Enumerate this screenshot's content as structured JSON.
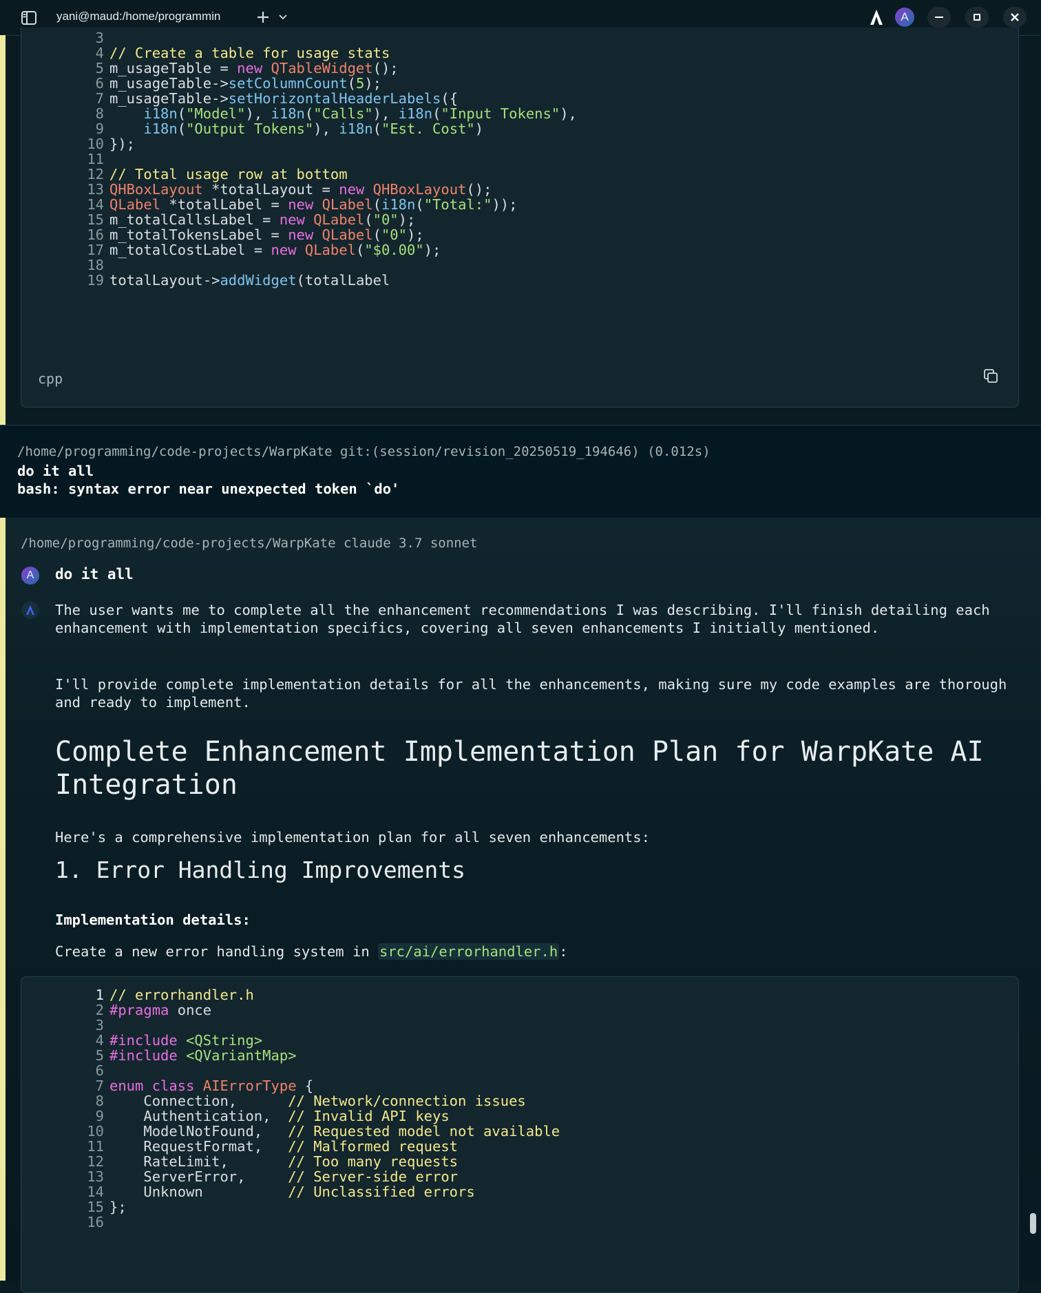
{
  "titlebar": {
    "tab_title": "yani@maud:/home/programmin",
    "icons": [
      "sidebar-icon",
      "plus-icon",
      "chevron-down-icon",
      "warp-logo-icon",
      "avatar",
      "minimize-icon",
      "maximize-icon",
      "close-icon"
    ],
    "avatar_letter": "A"
  },
  "colors": {
    "background": "#0b1b22",
    "accent_strip": "#eee9a0",
    "tab_underline": "#7a3ec9",
    "comment": "#f3e88a",
    "keyword": "#e86fe0",
    "type": "#f0826a",
    "function": "#7fc4ee",
    "string": "#a7e07a"
  },
  "code_block_1": {
    "language": "cpp",
    "lines": [
      {
        "n": "3",
        "tokens": []
      },
      {
        "n": "4",
        "tokens": [
          {
            "t": "// Create a table for usage stats",
            "c": "cm"
          }
        ]
      },
      {
        "n": "5",
        "tokens": [
          {
            "t": "m_usageTable = ",
            "c": ""
          },
          {
            "t": "new",
            "c": "kw"
          },
          {
            "t": " ",
            "c": ""
          },
          {
            "t": "QTableWidget",
            "c": "ty"
          },
          {
            "t": "();",
            "c": ""
          }
        ]
      },
      {
        "n": "6",
        "tokens": [
          {
            "t": "m_usageTable->",
            "c": ""
          },
          {
            "t": "setColumnCount",
            "c": "fn"
          },
          {
            "t": "(",
            "c": ""
          },
          {
            "t": "5",
            "c": "nu"
          },
          {
            "t": ");",
            "c": ""
          }
        ]
      },
      {
        "n": "7",
        "tokens": [
          {
            "t": "m_usageTable->",
            "c": ""
          },
          {
            "t": "setHorizontalHeaderLabels",
            "c": "fn"
          },
          {
            "t": "({",
            "c": ""
          }
        ]
      },
      {
        "n": "8",
        "tokens": [
          {
            "t": "    ",
            "c": ""
          },
          {
            "t": "i18n",
            "c": "fn"
          },
          {
            "t": "(",
            "c": ""
          },
          {
            "t": "\"Model\"",
            "c": "st"
          },
          {
            "t": "), ",
            "c": ""
          },
          {
            "t": "i18n",
            "c": "fn"
          },
          {
            "t": "(",
            "c": ""
          },
          {
            "t": "\"Calls\"",
            "c": "st"
          },
          {
            "t": "), ",
            "c": ""
          },
          {
            "t": "i18n",
            "c": "fn"
          },
          {
            "t": "(",
            "c": ""
          },
          {
            "t": "\"Input Tokens\"",
            "c": "st"
          },
          {
            "t": "),",
            "c": ""
          }
        ]
      },
      {
        "n": "9",
        "tokens": [
          {
            "t": "    ",
            "c": ""
          },
          {
            "t": "i18n",
            "c": "fn"
          },
          {
            "t": "(",
            "c": ""
          },
          {
            "t": "\"Output Tokens\"",
            "c": "st"
          },
          {
            "t": "), ",
            "c": ""
          },
          {
            "t": "i18n",
            "c": "fn"
          },
          {
            "t": "(",
            "c": ""
          },
          {
            "t": "\"Est. Cost\"",
            "c": "st"
          },
          {
            "t": ")",
            "c": ""
          }
        ]
      },
      {
        "n": "10",
        "tokens": [
          {
            "t": "});",
            "c": ""
          }
        ]
      },
      {
        "n": "11",
        "tokens": []
      },
      {
        "n": "12",
        "tokens": [
          {
            "t": "// Total usage row at bottom",
            "c": "cm"
          }
        ]
      },
      {
        "n": "13",
        "tokens": [
          {
            "t": "QHBoxLayout",
            "c": "ty"
          },
          {
            "t": " *totalLayout = ",
            "c": ""
          },
          {
            "t": "new",
            "c": "kw"
          },
          {
            "t": " ",
            "c": ""
          },
          {
            "t": "QHBoxLayout",
            "c": "ty"
          },
          {
            "t": "();",
            "c": ""
          }
        ]
      },
      {
        "n": "14",
        "tokens": [
          {
            "t": "QLabel",
            "c": "ty"
          },
          {
            "t": " *totalLabel = ",
            "c": ""
          },
          {
            "t": "new",
            "c": "kw"
          },
          {
            "t": " ",
            "c": ""
          },
          {
            "t": "QLabel",
            "c": "ty"
          },
          {
            "t": "(",
            "c": ""
          },
          {
            "t": "i18n",
            "c": "fn"
          },
          {
            "t": "(",
            "c": ""
          },
          {
            "t": "\"Total:\"",
            "c": "st"
          },
          {
            "t": "));",
            "c": ""
          }
        ]
      },
      {
        "n": "15",
        "tokens": [
          {
            "t": "m_totalCallsLabel = ",
            "c": ""
          },
          {
            "t": "new",
            "c": "kw"
          },
          {
            "t": " ",
            "c": ""
          },
          {
            "t": "QLabel",
            "c": "ty"
          },
          {
            "t": "(",
            "c": ""
          },
          {
            "t": "\"0\"",
            "c": "st"
          },
          {
            "t": ");",
            "c": ""
          }
        ]
      },
      {
        "n": "16",
        "tokens": [
          {
            "t": "m_totalTokensLabel = ",
            "c": ""
          },
          {
            "t": "new",
            "c": "kw"
          },
          {
            "t": " ",
            "c": ""
          },
          {
            "t": "QLabel",
            "c": "ty"
          },
          {
            "t": "(",
            "c": ""
          },
          {
            "t": "\"0\"",
            "c": "st"
          },
          {
            "t": ");",
            "c": ""
          }
        ]
      },
      {
        "n": "17",
        "tokens": [
          {
            "t": "m_totalCostLabel = ",
            "c": ""
          },
          {
            "t": "new",
            "c": "kw"
          },
          {
            "t": " ",
            "c": ""
          },
          {
            "t": "QLabel",
            "c": "ty"
          },
          {
            "t": "(",
            "c": ""
          },
          {
            "t": "\"$0.00\"",
            "c": "st"
          },
          {
            "t": ");",
            "c": ""
          }
        ]
      },
      {
        "n": "18",
        "tokens": []
      },
      {
        "n": "19",
        "tokens": [
          {
            "t": "totalLayout->",
            "c": ""
          },
          {
            "t": "addWidget",
            "c": "fn"
          },
          {
            "t": "(totalLabel",
            "c": ""
          }
        ]
      }
    ]
  },
  "shell": {
    "path_line": "/home/programming/code-projects/WarpKate git:(session/revision_20250519_194646) (0.012s)",
    "command": "do it all",
    "error": "bash: syntax error near unexpected token `do'"
  },
  "ai": {
    "path_line": "/home/programming/code-projects/WarpKate claude 3.7 sonnet",
    "user_avatar_letter": "A",
    "user_message": "do it all",
    "thinking_1": "The user wants me to complete all the enhancement recommendations I was describing. I'll finish detailing each enhancement with implementation specifics, covering all seven enhancements I initially mentioned.",
    "thinking_2": "I'll provide complete implementation details for all the enhancements, making sure my code examples are thorough and ready to implement.",
    "heading": "Complete Enhancement Implementation Plan for WarpKate AI Integration",
    "intro": "Here's a comprehensive implementation plan for all seven enhancements:",
    "section_title": "1. Error Handling Improvements",
    "details_label": "Implementation details:",
    "create_text": "Create a new error handling system in ",
    "create_path": "src/ai/errorhandler.h",
    "create_suffix": ":"
  },
  "code_block_2": {
    "lines": [
      {
        "n": "1",
        "active": true,
        "tokens": [
          {
            "t": "// errorhandler.h",
            "c": "cm"
          }
        ]
      },
      {
        "n": "2",
        "tokens": [
          {
            "t": "#pragma",
            "c": "kw"
          },
          {
            "t": " once",
            "c": ""
          }
        ]
      },
      {
        "n": "3",
        "tokens": []
      },
      {
        "n": "4",
        "tokens": [
          {
            "t": "#include",
            "c": "kw"
          },
          {
            "t": " ",
            "c": ""
          },
          {
            "t": "<QString>",
            "c": "st"
          }
        ]
      },
      {
        "n": "5",
        "tokens": [
          {
            "t": "#include",
            "c": "kw"
          },
          {
            "t": " ",
            "c": ""
          },
          {
            "t": "<QVariantMap>",
            "c": "st"
          }
        ]
      },
      {
        "n": "6",
        "tokens": []
      },
      {
        "n": "7",
        "tokens": [
          {
            "t": "enum",
            "c": "kw"
          },
          {
            "t": " ",
            "c": ""
          },
          {
            "t": "class",
            "c": "kw"
          },
          {
            "t": " ",
            "c": ""
          },
          {
            "t": "AIErrorType",
            "c": "ty"
          },
          {
            "t": " {",
            "c": ""
          }
        ]
      },
      {
        "n": "8",
        "tokens": [
          {
            "t": "    Connection,      ",
            "c": ""
          },
          {
            "t": "// Network/connection issues",
            "c": "cm"
          }
        ]
      },
      {
        "n": "9",
        "tokens": [
          {
            "t": "    Authentication,  ",
            "c": ""
          },
          {
            "t": "// Invalid API keys",
            "c": "cm"
          }
        ]
      },
      {
        "n": "10",
        "tokens": [
          {
            "t": "    ModelNotFound,   ",
            "c": ""
          },
          {
            "t": "// Requested model not available",
            "c": "cm"
          }
        ]
      },
      {
        "n": "11",
        "tokens": [
          {
            "t": "    RequestFormat,   ",
            "c": ""
          },
          {
            "t": "// Malformed request",
            "c": "cm"
          }
        ]
      },
      {
        "n": "12",
        "tokens": [
          {
            "t": "    RateLimit,       ",
            "c": ""
          },
          {
            "t": "// Too many requests",
            "c": "cm"
          }
        ]
      },
      {
        "n": "13",
        "tokens": [
          {
            "t": "    ServerError,     ",
            "c": ""
          },
          {
            "t": "// Server-side error",
            "c": "cm"
          }
        ]
      },
      {
        "n": "14",
        "tokens": [
          {
            "t": "    Unknown          ",
            "c": ""
          },
          {
            "t": "// Unclassified errors",
            "c": "cm"
          }
        ]
      },
      {
        "n": "15",
        "tokens": [
          {
            "t": "};",
            "c": ""
          }
        ]
      },
      {
        "n": "16",
        "tokens": []
      }
    ]
  }
}
